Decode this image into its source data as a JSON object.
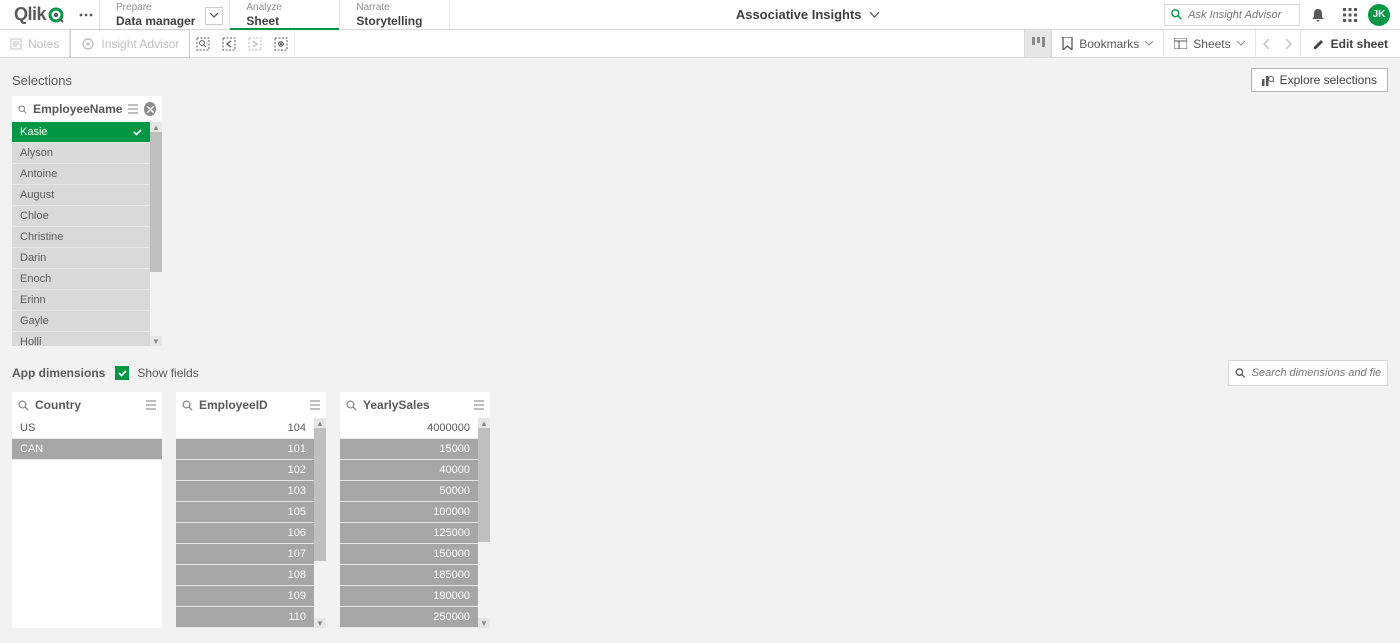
{
  "topbar": {
    "logo_text": "Qlik",
    "tabs": [
      {
        "top": "Prepare",
        "bottom": "Data manager",
        "dropdown": true,
        "active": false
      },
      {
        "top": "Analyze",
        "bottom": "Sheet",
        "dropdown": false,
        "active": true
      },
      {
        "top": "Narrate",
        "bottom": "Storytelling",
        "dropdown": false,
        "active": false
      }
    ],
    "center_title": "Associative Insights",
    "search_placeholder": "Ask Insight Advisor",
    "avatar_initials": "JK"
  },
  "toolbar": {
    "notes_label": "Notes",
    "insight_label": "Insight Advisor",
    "bookmarks_label": "Bookmarks",
    "sheets_label": "Sheets",
    "edit_label": "Edit sheet"
  },
  "selections": {
    "title": "Selections",
    "explore_label": "Explore selections",
    "panel": {
      "name": "EmployeeName",
      "items": [
        {
          "label": "Kasie",
          "state": "selected"
        },
        {
          "label": "Alyson",
          "state": "alternate"
        },
        {
          "label": "Antoine",
          "state": "alternate"
        },
        {
          "label": "August",
          "state": "alternate"
        },
        {
          "label": "Chloe",
          "state": "alternate"
        },
        {
          "label": "Christine",
          "state": "alternate"
        },
        {
          "label": "Darin",
          "state": "alternate"
        },
        {
          "label": "Enoch",
          "state": "alternate"
        },
        {
          "label": "Erinn",
          "state": "alternate"
        },
        {
          "label": "Gayle",
          "state": "alternate"
        },
        {
          "label": "Holli",
          "state": "alternate"
        }
      ]
    }
  },
  "dimensions": {
    "title": "App dimensions",
    "show_fields_label": "Show fields",
    "search_placeholder": "Search dimensions and fields",
    "panels": [
      {
        "name": "Country",
        "align": "left",
        "items": [
          {
            "label": "US",
            "state": "possible"
          },
          {
            "label": "CAN",
            "state": "excluded"
          }
        ],
        "scroll": false
      },
      {
        "name": "EmployeeID",
        "align": "right",
        "items": [
          {
            "label": "104",
            "state": "possible"
          },
          {
            "label": "101",
            "state": "excluded"
          },
          {
            "label": "102",
            "state": "excluded"
          },
          {
            "label": "103",
            "state": "excluded"
          },
          {
            "label": "105",
            "state": "excluded"
          },
          {
            "label": "106",
            "state": "excluded"
          },
          {
            "label": "107",
            "state": "excluded"
          },
          {
            "label": "108",
            "state": "excluded"
          },
          {
            "label": "109",
            "state": "excluded"
          },
          {
            "label": "110",
            "state": "excluded"
          }
        ],
        "scroll": true,
        "thumb": {
          "top": 0,
          "height": 70
        }
      },
      {
        "name": "YearlySales",
        "align": "right",
        "items": [
          {
            "label": "4000000",
            "state": "possible"
          },
          {
            "label": "15000",
            "state": "excluded"
          },
          {
            "label": "40000",
            "state": "excluded"
          },
          {
            "label": "50000",
            "state": "excluded"
          },
          {
            "label": "100000",
            "state": "excluded"
          },
          {
            "label": "125000",
            "state": "excluded"
          },
          {
            "label": "150000",
            "state": "excluded"
          },
          {
            "label": "185000",
            "state": "excluded"
          },
          {
            "label": "190000",
            "state": "excluded"
          },
          {
            "label": "250000",
            "state": "excluded"
          }
        ],
        "scroll": true,
        "thumb": {
          "top": 0,
          "height": 60
        }
      }
    ]
  }
}
